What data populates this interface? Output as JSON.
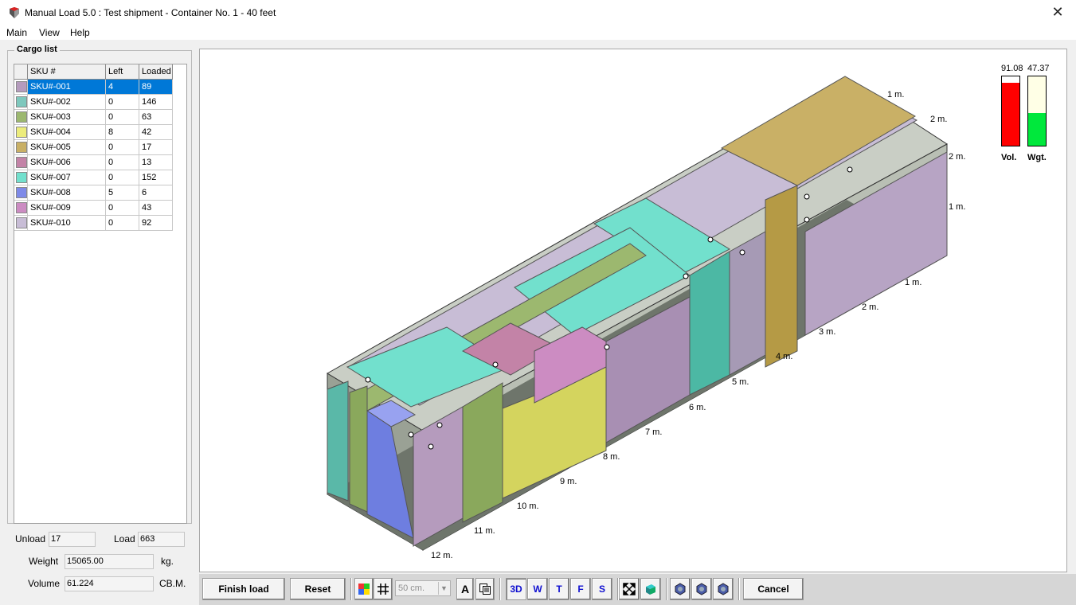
{
  "window": {
    "title": "Manual Load 5.0 : Test shipment - Container No. 1 - 40 feet",
    "close_glyph": "✕"
  },
  "menu": [
    {
      "label": "Main"
    },
    {
      "label": "View"
    },
    {
      "label": "Help"
    }
  ],
  "cargo_list": {
    "title": "Cargo list",
    "columns": {
      "sku": "SKU #",
      "left": "Left",
      "loaded": "Loaded"
    },
    "selected_index": 0,
    "rows": [
      {
        "sku": "SKU#-001",
        "left": "4",
        "loaded": "89",
        "color": "#b59bbd"
      },
      {
        "sku": "SKU#-002",
        "left": "0",
        "loaded": "146",
        "color": "#7ec8bd"
      },
      {
        "sku": "SKU#-003",
        "left": "0",
        "loaded": "63",
        "color": "#9cb86f"
      },
      {
        "sku": "SKU#-004",
        "left": "8",
        "loaded": "42",
        "color": "#ecec7c"
      },
      {
        "sku": "SKU#-005",
        "left": "0",
        "loaded": "17",
        "color": "#c9b066"
      },
      {
        "sku": "SKU#-006",
        "left": "0",
        "loaded": "13",
        "color": "#c383a7"
      },
      {
        "sku": "SKU#-007",
        "left": "0",
        "loaded": "152",
        "color": "#72e0cd"
      },
      {
        "sku": "SKU#-008",
        "left": "5",
        "loaded": "6",
        "color": "#7e8ae8"
      },
      {
        "sku": "SKU#-009",
        "left": "0",
        "loaded": "43",
        "color": "#cc8cc2"
      },
      {
        "sku": "SKU#-010",
        "left": "0",
        "loaded": "92",
        "color": "#c8bdd6"
      }
    ]
  },
  "summary": {
    "unload_label": "Unload",
    "unload_value": "17",
    "load_label": "Load",
    "load_value": "663",
    "weight_label": "Weight",
    "weight_value": "15065.00",
    "weight_unit": "kg.",
    "volume_label": "Volume",
    "volume_value": "61.224",
    "volume_unit": "CB.M."
  },
  "gauges": {
    "volume": {
      "value": "91.08",
      "label": "Vol.",
      "fill_percent": 91.08,
      "color": "#ff0000"
    },
    "weight": {
      "value": "47.37",
      "label": "Wgt.",
      "fill_percent": 47.37,
      "color": "#00e83c"
    }
  },
  "view3d": {
    "length_ticks": [
      "1 m.",
      "2 m.",
      "3 m.",
      "4 m.",
      "5 m.",
      "6 m.",
      "7 m.",
      "8 m.",
      "9 m.",
      "10 m.",
      "11 m.",
      "12 m."
    ],
    "top_ticks": [
      "1 m.",
      "2 m."
    ],
    "height_ticks": [
      "2 m.",
      "1 m."
    ]
  },
  "toolbar": {
    "finish_load": "Finish load",
    "reset": "Reset",
    "grid_step": "50 cm.",
    "font_button": "A",
    "view_3d": "3D",
    "view_w": "W",
    "view_t": "T",
    "view_f": "F",
    "view_s": "S",
    "cancel": "Cancel"
  }
}
